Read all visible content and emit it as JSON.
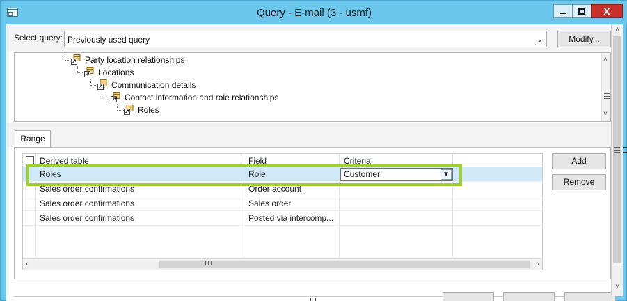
{
  "window": {
    "title": "Query - E-mail (3 - usmf)",
    "close_label": "X"
  },
  "query": {
    "select_label": "Select query:",
    "selected_value": "Previously used query",
    "modify_label": "Modify..."
  },
  "tree": {
    "nodes": [
      {
        "label": "Party location relationships",
        "icon": "table-join-icon"
      },
      {
        "label": "Locations",
        "icon": "table-join-icon"
      },
      {
        "label": "Communication details",
        "icon": "table-join-icon"
      },
      {
        "label": "Contact information and role relationships",
        "icon": "table-join-icon"
      },
      {
        "label": "Roles",
        "icon": "table-join-icon"
      }
    ]
  },
  "tabs": [
    {
      "label": "Range",
      "active": true
    }
  ],
  "grid": {
    "columns": [
      "Derived table",
      "Field",
      "Criteria"
    ],
    "rows": [
      {
        "table": "Roles",
        "field": "Role",
        "criteria": "Customer",
        "selected": true
      },
      {
        "table": "Sales order confirmations",
        "field": "Order account",
        "criteria": ""
      },
      {
        "table": "Sales order confirmations",
        "field": "Sales order",
        "criteria": ""
      },
      {
        "table": "Sales order confirmations",
        "field": "Posted via intercomp...",
        "criteria": ""
      }
    ]
  },
  "buttons": {
    "add": "Add",
    "remove": "Remove"
  },
  "colors": {
    "titlebar": "#6cc7ec",
    "highlight": "#9fd12e",
    "selected_row": "#cfe9f8",
    "close_button": "#c7302b"
  }
}
